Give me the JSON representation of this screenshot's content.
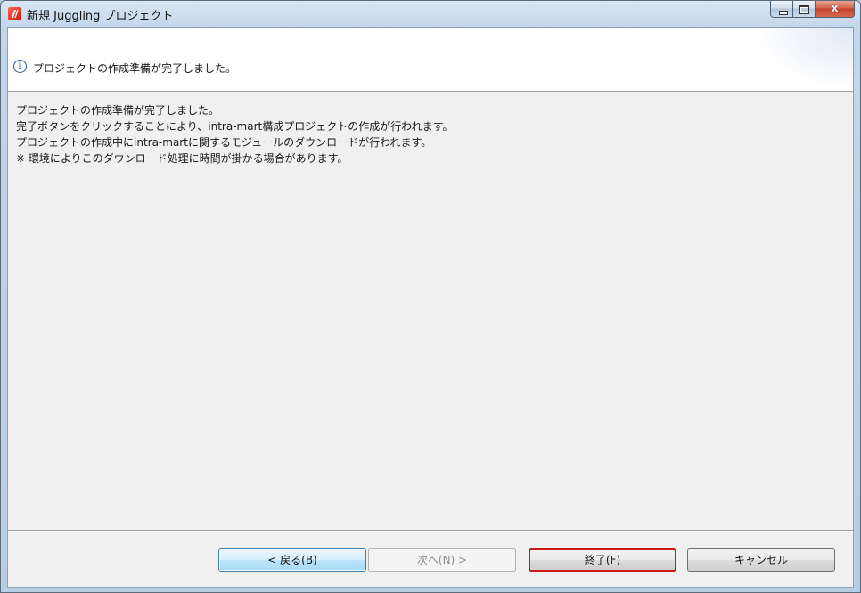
{
  "window": {
    "title": "新規 Juggling プロジェクト",
    "controls": {
      "close_glyph": "x"
    }
  },
  "banner": {
    "icon": "info-icon",
    "message": "プロジェクトの作成準備が完了しました。"
  },
  "body": {
    "lines": [
      "プロジェクトの作成準備が完了しました。",
      "完了ボタンをクリックすることにより、intra-mart構成プロジェクトの作成が行われます。",
      "プロジェクトの作成中にintra-martに関するモジュールのダウンロードが行われます。",
      "※ 環境によりこのダウンロード処理に時間が掛かる場合があります。"
    ]
  },
  "buttons": {
    "back": "< 戻る(B)",
    "next": "次へ(N) >",
    "finish": "終了(F)",
    "cancel": "キャンセル"
  },
  "colors": {
    "finish_highlight": "#cc1a1a",
    "focus_blue": "#3c7fb1"
  }
}
